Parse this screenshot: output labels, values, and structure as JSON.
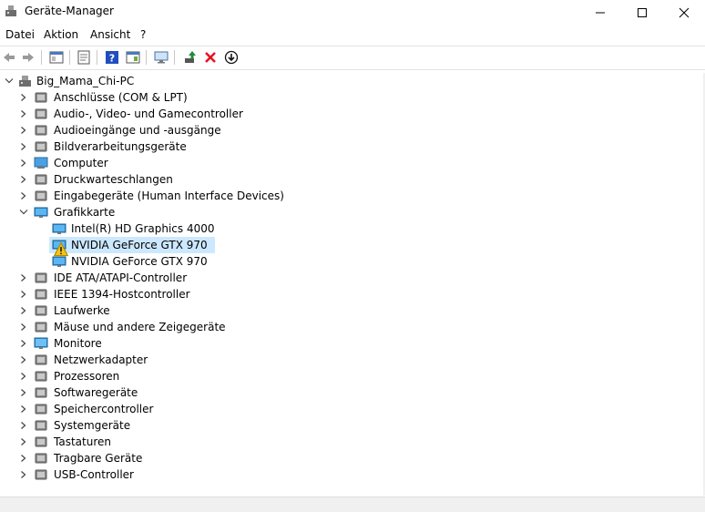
{
  "window": {
    "title": "Geräte-Manager"
  },
  "menu": [
    "Datei",
    "Aktion",
    "Ansicht",
    "?"
  ],
  "toolbar": [
    "back-icon",
    "forward-icon",
    "show-hide-icon",
    "properties-icon",
    "help-icon",
    "view-icon",
    "monitor-scan-icon",
    "update-driver-icon",
    "uninstall-icon",
    "download-icon"
  ],
  "tree": {
    "root": "Big_Mama_Chi-PC",
    "categories": [
      "Anschlüsse (COM & LPT)",
      "Audio-, Video- und Gamecontroller",
      "Audioeingänge und -ausgänge",
      "Bildverarbeitungsgeräte",
      "Computer",
      "Druckwarteschlangen",
      "Eingabegeräte (Human Interface Devices)",
      "Grafikkarte",
      "IDE ATA/ATAPI-Controller",
      "IEEE 1394-Hostcontroller",
      "Laufwerke",
      "Mäuse und andere Zeigegeräte",
      "Monitore",
      "Netzwerkadapter",
      "Prozessoren",
      "Softwaregeräte",
      "Speichercontroller",
      "Systemgeräte",
      "Tastaturen",
      "Tragbare Geräte",
      "USB-Controller"
    ],
    "grafik_children": [
      "Intel(R) HD Graphics 4000",
      "NVIDIA GeForce GTX 970",
      "NVIDIA GeForce GTX 970"
    ]
  },
  "colors": {
    "selection": "#cce8ff",
    "warning": "#f5c518",
    "uninstall": "#e81123",
    "help": "#1f4fbf",
    "update": "#1e8c3a"
  }
}
